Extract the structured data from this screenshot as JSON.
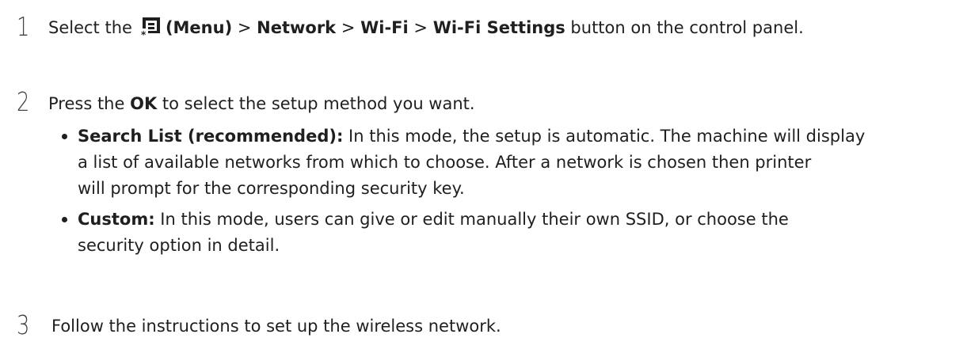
{
  "steps": [
    {
      "number": "1",
      "parts": {
        "select": "Select the",
        "menu": "(Menu)",
        "sep1": " > ",
        "network": "Network",
        "sep2": " > ",
        "wifi": "Wi-Fi",
        "sep3": " > ",
        "wifi_settings": "Wi-Fi Settings",
        "rest": " button on the control panel."
      }
    },
    {
      "number": "2",
      "parts": {
        "press": "Press the ",
        "ok": "OK",
        "rest": " to select the setup method you want."
      },
      "bullets": [
        {
          "term": "Search List (recommended):",
          "lines": [
            " In this mode, the setup is automatic. The machine will display",
            "a list of available networks from which to choose. After a network is chosen then printer",
            "will prompt for the corresponding security key."
          ]
        },
        {
          "term": "Custom:",
          "lines": [
            " In this mode, users can give or edit manually their own SSID, or choose the",
            "security option in detail."
          ]
        }
      ]
    },
    {
      "number": "3",
      "parts": {
        "text": "Follow the instructions to set up the wireless network."
      }
    }
  ],
  "icons": {
    "menu": "menu-icon"
  }
}
